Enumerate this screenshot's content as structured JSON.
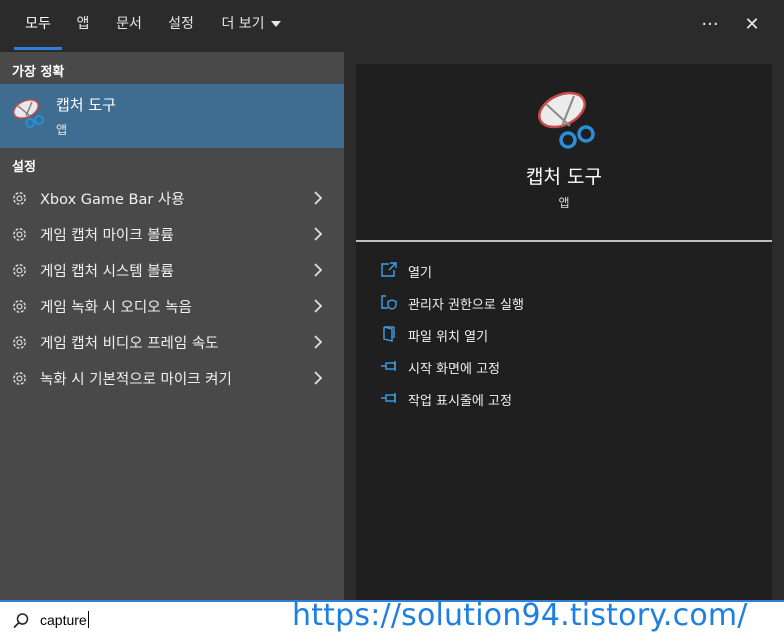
{
  "tabs": [
    {
      "label": "모두",
      "active": true
    },
    {
      "label": "앱"
    },
    {
      "label": "문서"
    },
    {
      "label": "설정"
    },
    {
      "label": "더 보기"
    }
  ],
  "top_actions": {
    "more_icon": "ellipsis-icon",
    "more_glyph": "···",
    "close_icon": "close-icon",
    "close_glyph": "✕"
  },
  "left": {
    "best_match_title": "가장 정확",
    "best_match": {
      "name": "캡처 도구",
      "kind": "앱",
      "icon": "snipping-tool-icon"
    },
    "settings_title": "설정",
    "settings_items": [
      "Xbox Game Bar 사용",
      "게임 캡처 마이크 볼륨",
      "게임 캡처 시스템 볼륨",
      "게임 녹화 시 오디오 녹음",
      "게임 캡처 비디오 프레임 속도",
      "녹화 시 기본적으로 마이크 켜기"
    ]
  },
  "preview": {
    "name": "캡처 도구",
    "kind": "앱",
    "actions": [
      {
        "label": "열기",
        "icon": "open-icon"
      },
      {
        "label": "관리자 권한으로 실행",
        "icon": "shield-icon"
      },
      {
        "label": "파일 위치 열기",
        "icon": "file-location-icon"
      },
      {
        "label": "시작 화면에 고정",
        "icon": "pin-icon"
      },
      {
        "label": "작업 표시줄에 고정",
        "icon": "pin-icon"
      }
    ]
  },
  "search": {
    "value": "capture",
    "watermark": "https://solution94.tistory.com/"
  },
  "colors": {
    "accent": "#2f7ed8",
    "selected": "#3f6d91",
    "left_bg": "#494949",
    "right_bg": "#1f1f1f",
    "watermark": "#1f7fe0"
  }
}
